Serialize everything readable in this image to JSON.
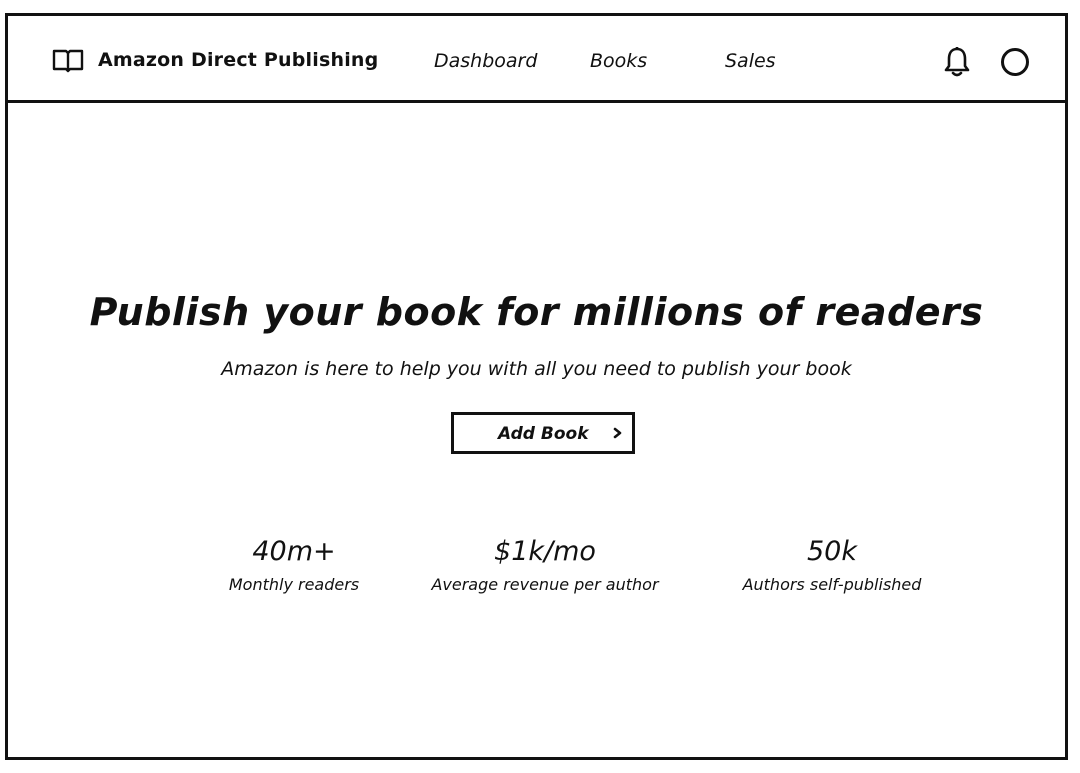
{
  "header": {
    "brand_name": "Amazon Direct Publishing",
    "brand_icon": "open-book-icon",
    "nav": [
      {
        "label": "Dashboard"
      },
      {
        "label": "Books"
      },
      {
        "label": "Sales"
      }
    ],
    "notification_icon": "bell-icon",
    "profile_icon": "user-avatar-icon"
  },
  "hero": {
    "title": "Publish your book for millions of readers",
    "subtitle": "Amazon is here to help you with all you need to publish your book",
    "cta_label": "Add Book",
    "cta_icon": "chevron-right-icon"
  },
  "stats": [
    {
      "value": "40m+",
      "label": "Monthly readers"
    },
    {
      "value": "$1k/mo",
      "label": "Average revenue per author"
    },
    {
      "value": "50k",
      "label": "Authors self-published"
    }
  ],
  "colors": {
    "ink": "#111111",
    "background": "#ffffff"
  }
}
